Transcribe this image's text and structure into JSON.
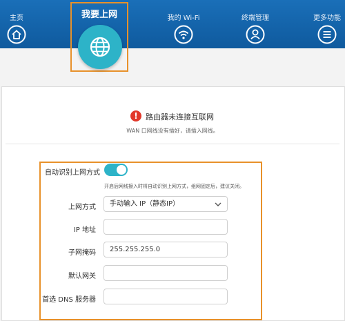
{
  "nav": {
    "items": [
      {
        "label": "主页",
        "icon": "home-icon"
      },
      {
        "label": "我要上网",
        "icon": "globe-icon"
      },
      {
        "label": "我的 Wi-Fi",
        "icon": "wifi-icon"
      },
      {
        "label": "终端管理",
        "icon": "user-icon"
      },
      {
        "label": "更多功能",
        "icon": "menu-icon"
      }
    ]
  },
  "status": {
    "title": "路由器未连接互联网",
    "subtitle": "WAN 口网线没有插好，请插入网线。",
    "icon": "warning-icon",
    "color": "#e2382a"
  },
  "form": {
    "auto_detect": {
      "label": "自动识别上网方式",
      "enabled": true,
      "hint": "开启后网线接入时将自动识别上网方式，组网固定后，建议关闭。"
    },
    "fields": [
      {
        "label": "上网方式",
        "value": "手动输入 IP（静态IP）",
        "type": "select"
      },
      {
        "label": "IP 地址",
        "value": "",
        "type": "input"
      },
      {
        "label": "子网掩码",
        "value": "255.255.255.0",
        "type": "input"
      },
      {
        "label": "默认网关",
        "value": "",
        "type": "input"
      },
      {
        "label": "首选 DNS 服务器",
        "value": "",
        "type": "input"
      }
    ]
  },
  "colors": {
    "accent": "#2db3c8",
    "header": "#1563aa",
    "highlight": "#e8912a"
  }
}
